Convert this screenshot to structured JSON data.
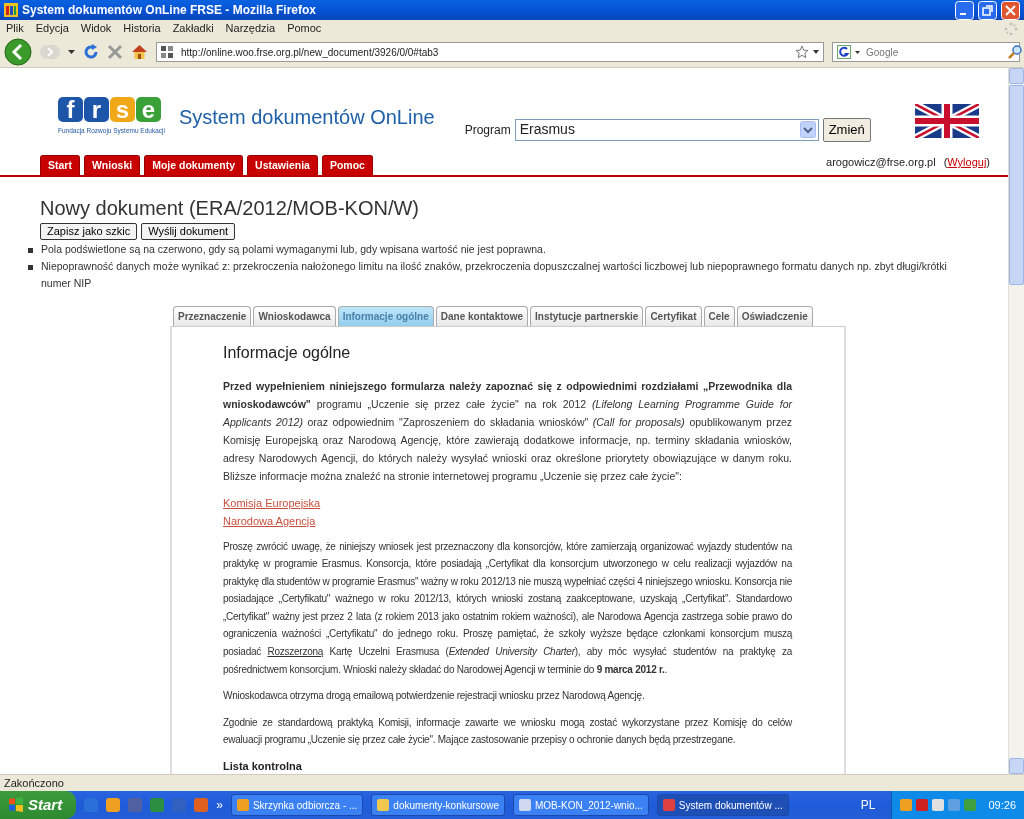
{
  "window": {
    "title": "System dokumentów OnLine FRSE - Mozilla Firefox"
  },
  "menu": [
    "Plik",
    "Edycja",
    "Widok",
    "Historia",
    "Zakładki",
    "Narzędzia",
    "Pomoc"
  ],
  "toolbar": {
    "url": "http://online.woo.frse.org.pl/new_document/3926/0/0#tab3",
    "search_placeholder": "Google"
  },
  "header": {
    "logo_letters": [
      "f",
      "r",
      "s",
      "e"
    ],
    "logo_caption": "Fundacja Rozwoju Systemu Edukacji",
    "site_title": "System dokumentów OnLine",
    "program_label": "Program",
    "program_value": "Erasmus",
    "change_button": "Zmień"
  },
  "nav": [
    "Start",
    "Wnioski",
    "Moje dokumenty",
    "Ustawienia",
    "Pomoc"
  ],
  "user": {
    "email": "arogowicz@frse.org.pl",
    "logout_prefix": "(",
    "logout": "Wyloguj",
    "logout_suffix": ")"
  },
  "document": {
    "title": "Nowy dokument (ERA/2012/MOB-KON/W)",
    "buttons": [
      "Zapisz jako szkic",
      "Wyślij dokument"
    ],
    "notes": [
      "Pola podświetlone są na czerwono, gdy są polami wymaganymi lub, gdy wpisana wartość nie jest poprawna.",
      "Niepoprawność danych może wynikać z: przekroczenia nałożonego limitu na ilość znaków, przekroczenia dopuszczalnej wartości liczbowej lub niepoprawnego formatu danych np. zbyt długi/krótki numer NIP"
    ]
  },
  "form_tabs": [
    {
      "label": "Przeznaczenie",
      "selected": false
    },
    {
      "label": "Wnioskodawca",
      "selected": false
    },
    {
      "label": "Informacje ogólne",
      "selected": true
    },
    {
      "label": "Dane kontaktowe",
      "selected": false
    },
    {
      "label": "Instytucje partnerskie",
      "selected": false
    },
    {
      "label": "Certyfikat",
      "selected": false
    },
    {
      "label": "Cele",
      "selected": false
    },
    {
      "label": "Oświadczenie",
      "selected": false
    }
  ],
  "section": {
    "heading": "Informacje ogólne",
    "intro": "**Przed wypełnieniem niniejszego formularza należy zapoznać się z odpowiednimi rozdziałami „Przewodnika dla wnioskodawców\"** programu „Uczenie się przez całe życie\" na rok 2012 *(Lifelong Learning Programme Guide for Applicants 2012)* oraz odpowiednim \"Zaproszeniem do składania wniosków\" *(Call for proposals)* opublikowanym przez Komisję Europejską oraz Narodową Agencję, które zawierają dodatkowe informacje, np. terminy składania wniosków, adresy Narodowych Agencji, do których należy wysyłać wnioski oraz określone priorytety obowiązujące w danym roku. Bliższe informacje można znaleźć na stronie internetowej programu „Uczenie się przez całe życie\":",
    "links": [
      "Komisja Europejska",
      "Narodowa Agencja"
    ],
    "notice_parts": [
      {
        "text": "Proszę zwrócić uwagę, że niniejszy wniosek jest przeznaczony dla konsorcjów, które zamierzają organizować wyjazdy studentów na praktykę w programie Erasmus. Konsorcja, które posiadają „Certyfikat dla konsorcjum utworzonego w celu realizacji wyjazdów na praktykę dla studentów w programie Erasmus\" ważny w roku 2012/13 nie muszą wypełniać części 4 niniejszego wniosku. Konsorcja nie posiadające „Certyfikatu\" ważnego w roku 2012/13, których wnioski zostaną zaakceptowane, uzyskają „Certyfikat\". Standardowo „Certyfikat\" ważny jest przez 2 lata (z rokiem 2013 jako ostatnim rokiem ważności), ale Narodowa Agencja zastrzega sobie prawo do ograniczenia ważności „Certyfikatu\" do jednego roku. Proszę pamiętać, że szkoły wyższe będące członkami konsorcjum muszą posiadać ",
        "underline": false
      },
      {
        "text": "Rozszerzoną",
        "underline": true
      },
      {
        "text": " Kartę Uczelni Erasmusa (*Extended University Charter*), aby móc wysyłać studentów na praktykę za pośrednictwem konsorcjum. Wnioski należy składać do Narodowej Agencji w terminie do **9 marca 2012 r.**.",
        "underline": false
      }
    ],
    "paragraphs": [
      "Wnioskodawca otrzyma drogą emailową potwierdzenie rejestracji wniosku przez Narodową Agencję.",
      "Zgodnie ze standardową praktyką Komisji, informacje zawarte we wniosku mogą zostać wykorzystane przez Komisję do celów ewaluacji programu „Uczenie się przez całe życie\". Mające zastosowanie przepisy o ochronie danych będą przestrzegane."
    ],
    "checklist_heading": "Lista kontrolna"
  },
  "status_bar": "Zakończono",
  "taskbar": {
    "start": "Start",
    "overflow": "»",
    "tasks": [
      {
        "label": "Skrzynka odbiorcza - ...",
        "selected": false
      },
      {
        "label": "dokumenty-konkursowe",
        "selected": false
      },
      {
        "label": "MOB-KON_2012-wnio...",
        "selected": false
      },
      {
        "label": "System dokumentów ...",
        "selected": true
      }
    ],
    "language": "PL",
    "clock": "09:26"
  }
}
